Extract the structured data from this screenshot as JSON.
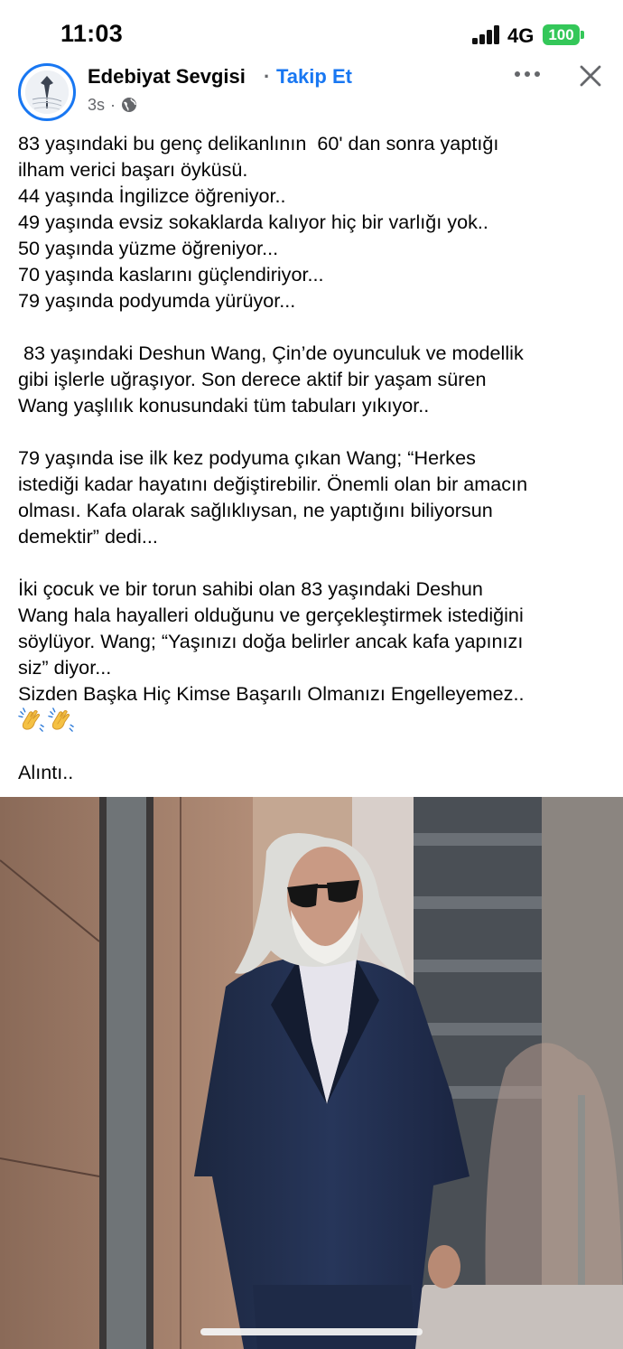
{
  "status_bar": {
    "time": "11:03",
    "network": "4G",
    "battery": "100",
    "battery_color": "#34c759"
  },
  "post": {
    "page_name": "Edebiyat Sevgisi",
    "separator": "·",
    "follow_label": "Takip Et",
    "timestamp": "3s",
    "meta_separator": "·",
    "audience_icon": "globe-icon",
    "accent_color": "#1877f2",
    "paragraphs": [
      "83 yaşındaki bu genç delikanlının  60' dan sonra yaptığı",
      "ilham verici başarı öyküsü.",
      "44 yaşında İngilizce öğreniyor..",
      "49 yaşında evsiz sokaklarda kalıyor hiç bir varlığı yok..",
      "50 yaşında yüzme öğreniyor...",
      "70 yaşında kaslarını güçlendiriyor...",
      "79 yaşında podyumda yürüyor...",
      "",
      " 83 yaşındaki Deshun Wang, Çin’de oyunculuk ve modellik",
      "gibi işlerle uğraşıyor. Son derece aktif bir yaşam süren",
      "Wang yaşlılık konusundaki tüm tabuları yıkıyor..",
      "",
      "79 yaşında ise ilk kez podyuma çıkan Wang; “Herkes",
      "istediği kadar hayatını değiştirebilir. Önemli olan bir amacın",
      "olması. Kafa olarak sağlıklıysan, ne yaptığını biliyorsun",
      "demektir” dedi...",
      "",
      "İki çocuk ve bir torun sahibi olan 83 yaşındaki Deshun",
      "Wang hala hayalleri olduğunu ve gerçekleştirmek istediğini",
      "söylüyor. Wang; “Yaşınızı doğa belirler ancak kafa yapınızı",
      "siz” diyor...",
      "Sizden Başka Hiç Kimse Başarılı Olmanızı Engelleyemez.."
    ],
    "emoji_icons": [
      "clapping-hands-icon",
      "clapping-hands-icon"
    ],
    "closing_blank": "",
    "closing": "Alıntı..",
    "photo_icon": "photo-elderly-man-in-suit"
  }
}
